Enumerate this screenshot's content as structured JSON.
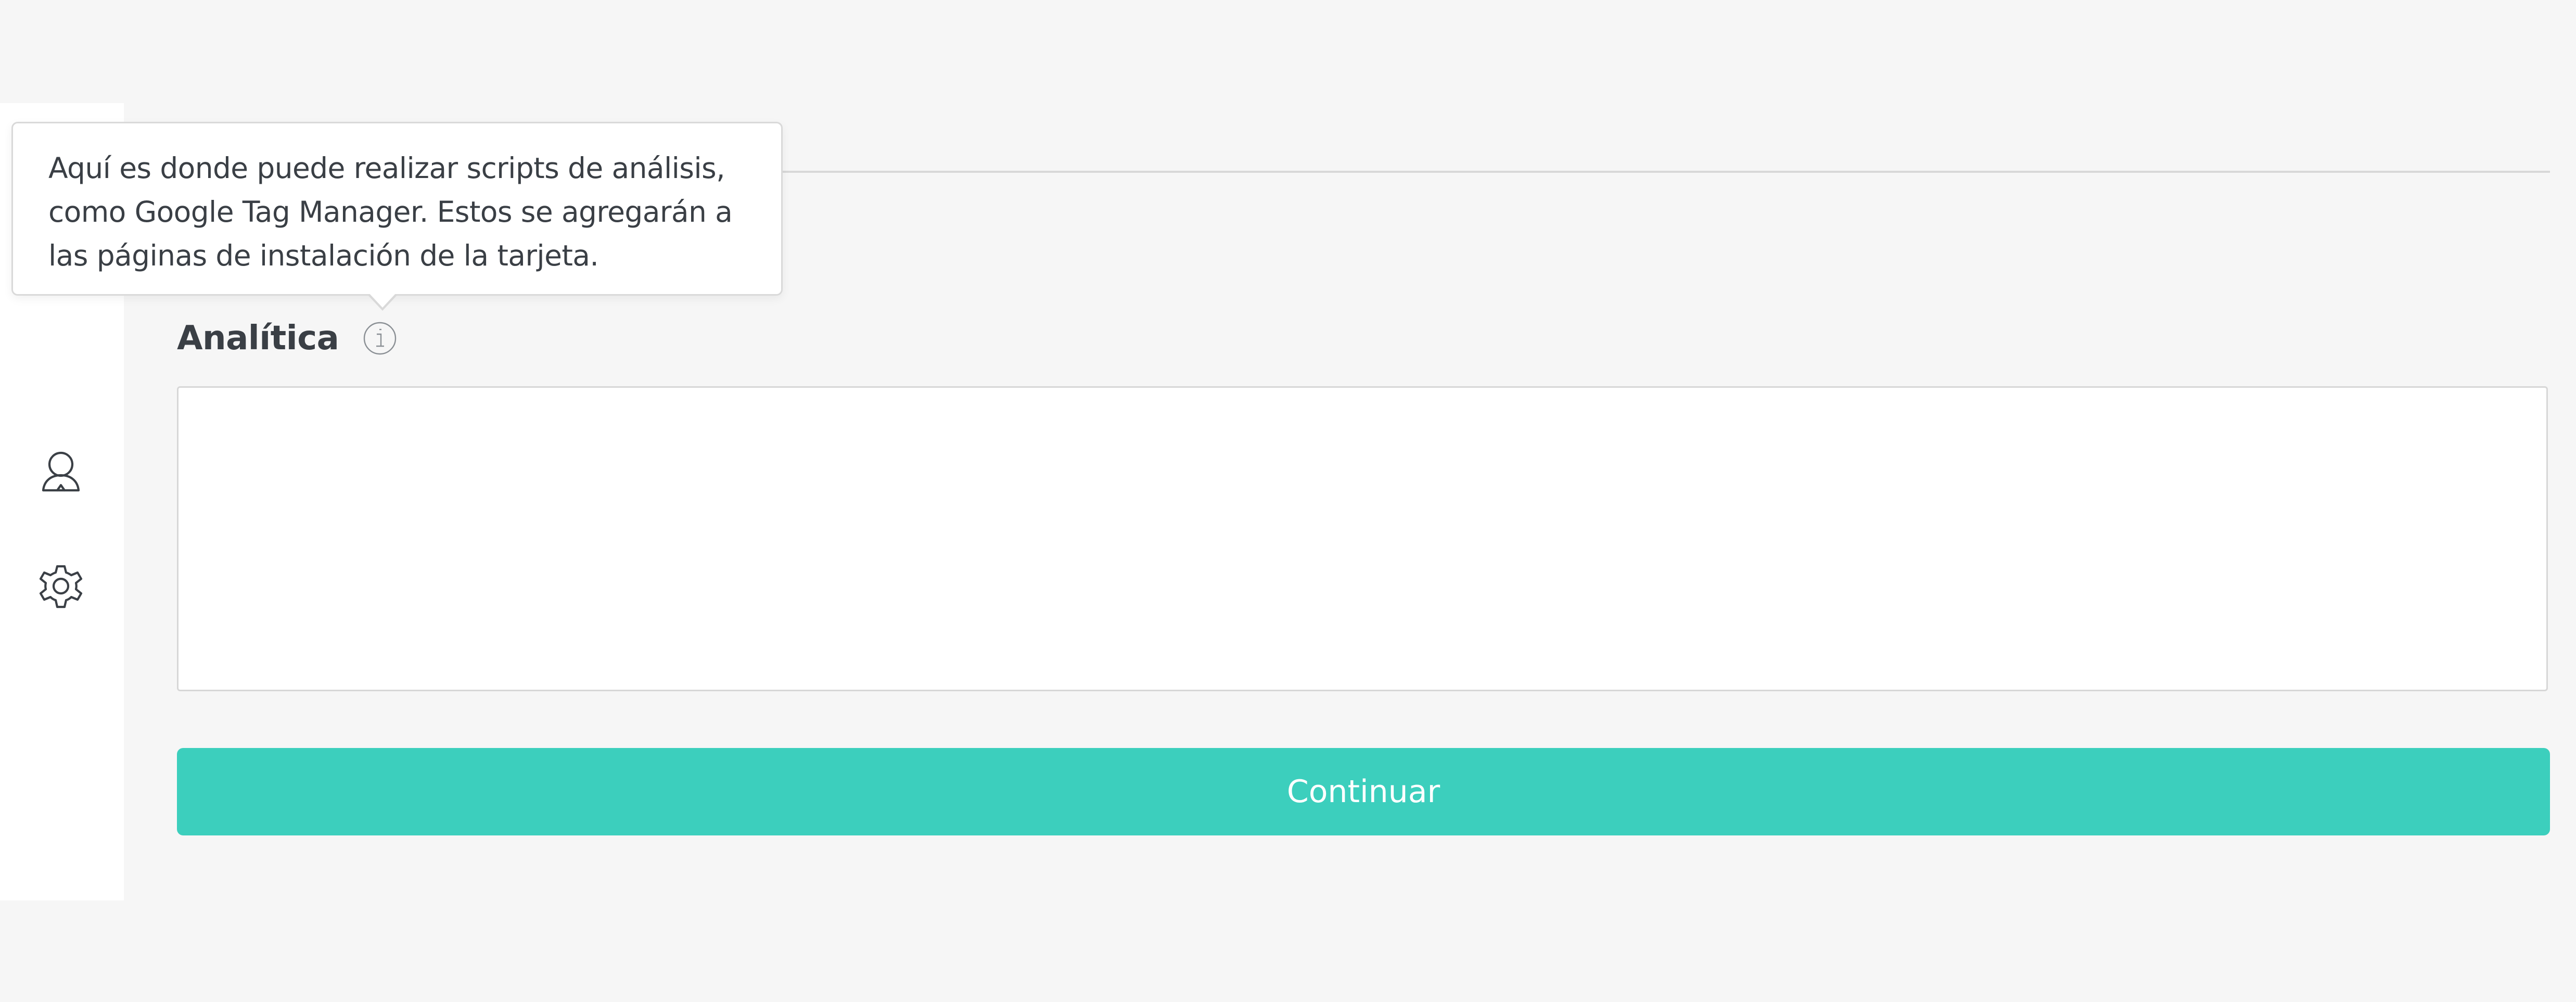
{
  "tooltip": {
    "text": "Aquí es donde puede realizar scripts de análisis, como Google Tag Manager. Estos se agregarán a las páginas de instalación de la tarjeta."
  },
  "sidebar": {
    "icons": [
      "user-icon",
      "gear-icon"
    ]
  },
  "analytics": {
    "label": "Analítica",
    "info_icon": "info-icon",
    "value": "",
    "placeholder": ""
  },
  "actions": {
    "continue_label": "Continuar"
  },
  "colors": {
    "accent": "#3ccfbd",
    "background": "#f6f6f6",
    "sidebar": "#ffffff",
    "text": "#3a3f45"
  }
}
